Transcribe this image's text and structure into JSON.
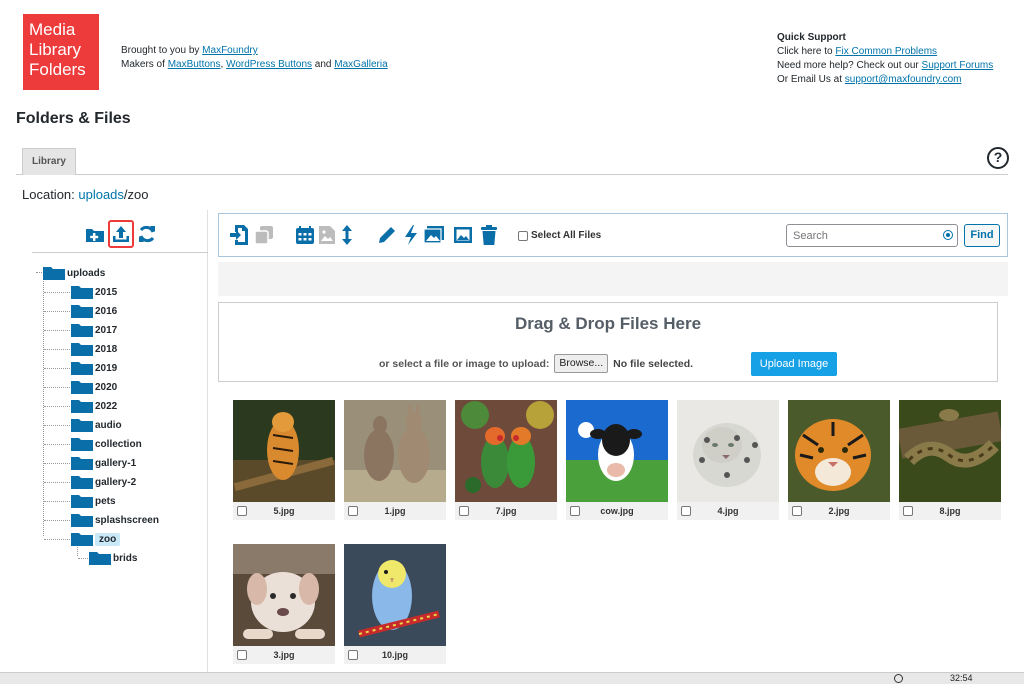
{
  "header": {
    "logo_lines": [
      "Media",
      "Library",
      "Folders"
    ],
    "brought_prefix": "Brought to you by ",
    "brought_link": "MaxFoundry",
    "makers_prefix": "Makers of ",
    "makers_link1": "MaxButtons",
    "makers_sep": ", ",
    "makers_link2": "WordPress Buttons",
    "makers_and": " and ",
    "makers_link3": "MaxGalleria"
  },
  "support": {
    "title": "Quick Support",
    "line1_prefix": "Click here to ",
    "line1_link": "Fix Common Problems",
    "line2_prefix": "Need more help? Check out our ",
    "line2_link": "Support Forums",
    "line3_prefix": "Or Email Us at ",
    "line3_link": "support@maxfoundry.com"
  },
  "page_title": "Folders & Files",
  "tabs": [
    {
      "label": "Library"
    }
  ],
  "help_icon": "?",
  "location": {
    "label": "Location: ",
    "link": "uploads",
    "path": "/zoo"
  },
  "tree_tools": [
    "add-folder-icon",
    "upload-icon",
    "refresh-icon"
  ],
  "tree": {
    "root": "uploads",
    "children": [
      "2015",
      "2016",
      "2017",
      "2018",
      "2019",
      "2020",
      "2022",
      "audio",
      "collection",
      "gallery-1",
      "gallery-2",
      "pets",
      "splashscreen",
      "zoo"
    ],
    "selected": "zoo",
    "zoo_children": [
      "brids"
    ]
  },
  "toolbar": {
    "icons": [
      "move-icon",
      "copy-icon",
      "calendar-sort-icon",
      "image-sort-icon",
      "sort-order-icon",
      "rename-icon",
      "regenerate-icon",
      "gallery-icon",
      "edit-image-icon",
      "trash-icon"
    ],
    "select_all_label": "Select All Files",
    "search_placeholder": "Search",
    "find_label": "Find"
  },
  "dropzone": {
    "heading": "Drag & Drop Files Here",
    "prompt": "or select a file or image to upload:",
    "browse_label": "Browse...",
    "no_file": "No file selected.",
    "upload_label": "Upload Image"
  },
  "files": [
    {
      "name": "5.jpg",
      "subject": "tiger-on-log"
    },
    {
      "name": "1.jpg",
      "subject": "kangaroos"
    },
    {
      "name": "7.jpg",
      "subject": "lovebirds"
    },
    {
      "name": "cow.jpg",
      "subject": "cow"
    },
    {
      "name": "4.jpg",
      "subject": "snow-leopard"
    },
    {
      "name": "2.jpg",
      "subject": "tiger-face"
    },
    {
      "name": "8.jpg",
      "subject": "snake"
    },
    {
      "name": "3.jpg",
      "subject": "puppy"
    },
    {
      "name": "10.jpg",
      "subject": "budgie"
    }
  ],
  "taskbar": {
    "time": "32:54"
  }
}
